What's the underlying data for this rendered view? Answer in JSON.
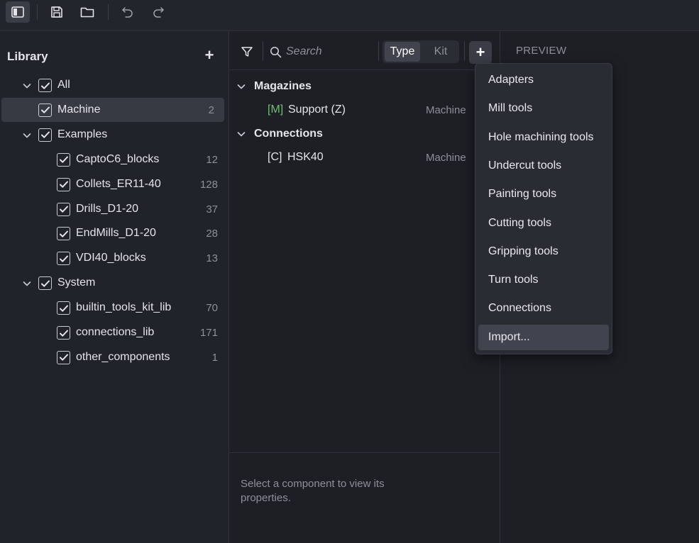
{
  "toolbar": {
    "buttons": [
      {
        "icon": "sidebar-toggle-icon",
        "active": true
      },
      {
        "icon": "save-icon"
      },
      {
        "icon": "folder-icon"
      },
      {
        "icon": "undo-icon"
      },
      {
        "icon": "redo-icon"
      }
    ]
  },
  "library": {
    "title": "Library",
    "add_label": "+",
    "tree": [
      {
        "label": "All",
        "expanded": true,
        "checked": true,
        "level": 0
      },
      {
        "label": "Machine",
        "count": "2",
        "checked": true,
        "level": 1,
        "selected": true
      },
      {
        "label": "Examples",
        "expanded": true,
        "checked": true,
        "level": 0
      },
      {
        "label": "CaptoC6_blocks",
        "count": "12",
        "checked": true,
        "level": 2
      },
      {
        "label": "Collets_ER11-40",
        "count": "128",
        "checked": true,
        "level": 2
      },
      {
        "label": "Drills_D1-20",
        "count": "37",
        "checked": true,
        "level": 2
      },
      {
        "label": "EndMills_D1-20",
        "count": "28",
        "checked": true,
        "level": 2
      },
      {
        "label": "VDI40_blocks",
        "count": "13",
        "checked": true,
        "level": 2
      },
      {
        "label": "System",
        "expanded": true,
        "checked": true,
        "level": 0
      },
      {
        "label": "builtin_tools_kit_lib",
        "count": "70",
        "checked": true,
        "level": 2
      },
      {
        "label": "connections_lib",
        "count": "171",
        "checked": true,
        "level": 2
      },
      {
        "label": "other_components",
        "count": "1",
        "checked": true,
        "level": 2
      }
    ]
  },
  "components": {
    "search": {
      "placeholder": "Search"
    },
    "view_toggle": {
      "type_label": "Type",
      "kit_label": "Kit",
      "selected": "Type"
    },
    "add_label": "+",
    "groups": [
      {
        "label": "Magazines",
        "items": [
          {
            "prefix": "[M]",
            "name": "Support (Z)",
            "type": "Machine"
          }
        ]
      },
      {
        "label": "Connections",
        "items": [
          {
            "prefix": "[C]",
            "name": "HSK40",
            "type": "Machine"
          }
        ]
      }
    ],
    "properties_hint": "Select a component to view its properties."
  },
  "preview": {
    "title": "PREVIEW"
  },
  "add_menu": {
    "items": [
      "Adapters",
      "Mill tools",
      "Hole machining tools",
      "Undercut tools",
      "Painting tools",
      "Cutting tools",
      "Gripping tools",
      "Turn tools",
      "Connections",
      "Import..."
    ],
    "hovered": "Import..."
  },
  "colors": {
    "background": "#1f2128",
    "accent_magazine": "#6cc070",
    "muted_text": "#8d9099"
  }
}
